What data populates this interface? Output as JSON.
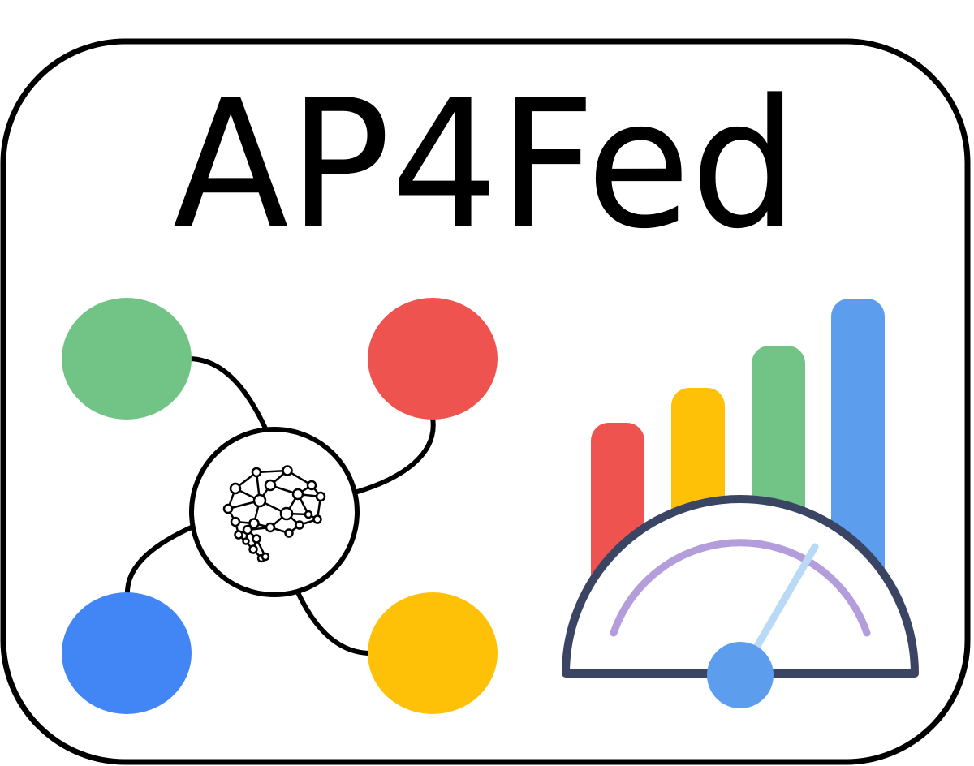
{
  "logo": {
    "title": "AP4Fed"
  },
  "colors": {
    "outline": "#000000",
    "background": "#ffffff",
    "green": "#72C386",
    "red": "#EF5350",
    "blue": "#4285F4",
    "yellow": "#FFC107",
    "bar_blue": "#5C9DEE",
    "gauge_frame": "#3A4564",
    "gauge_arc": "#B39DDB",
    "gauge_needle": "#B9DAF7",
    "gauge_hub": "#5C9DEE"
  },
  "icons": {
    "network": "federated-network-icon",
    "brain": "brain-network-icon",
    "bars": "bar-chart-icon",
    "gauge": "speedometer-gauge-icon"
  }
}
